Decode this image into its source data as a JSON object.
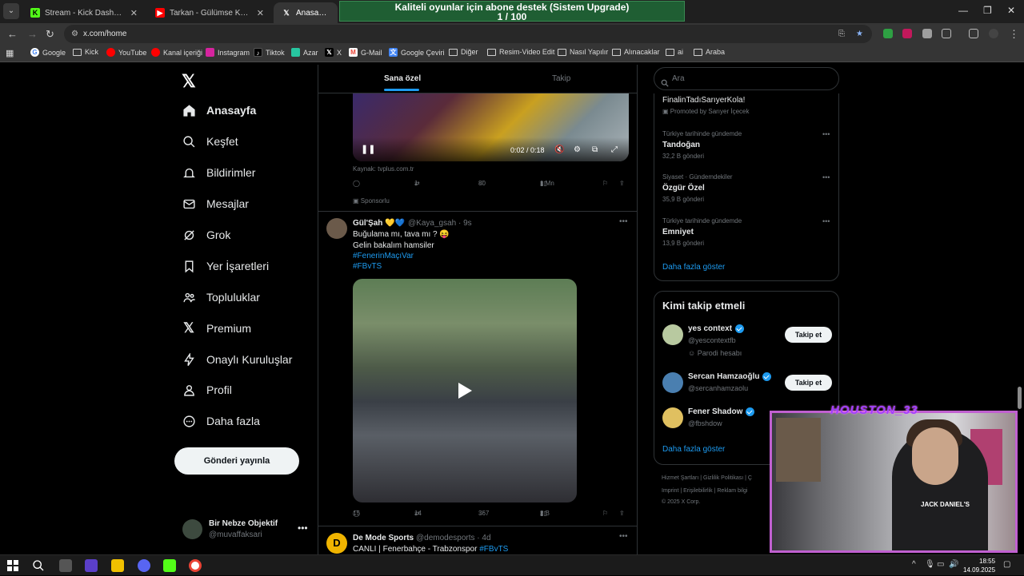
{
  "browser": {
    "tabs": [
      {
        "title": "Stream - Kick Dashboard",
        "favicon": "kick-icon",
        "color": "#53fc18"
      },
      {
        "title": "Tarkan - Gülümse Kaderine (Eng",
        "favicon": "youtube-icon",
        "color": "#ff0000"
      },
      {
        "title": "Anasayfa / X",
        "favicon": "x-icon",
        "color": "#ffffff",
        "active": true
      }
    ],
    "address": "x.com/home",
    "bookmarks": [
      {
        "label": "Google",
        "icon": "google-icon"
      },
      {
        "label": "Kick",
        "icon": "folder-icon"
      },
      {
        "label": "YouTube",
        "icon": "youtube-icon"
      },
      {
        "label": "Kanal içeriği",
        "icon": "youtube-icon"
      },
      {
        "label": "Instagram",
        "icon": "instagram-icon"
      },
      {
        "label": "Tiktok",
        "icon": "tiktok-icon"
      },
      {
        "label": "Azar",
        "icon": "azar-icon"
      },
      {
        "label": "X",
        "icon": "x-icon"
      },
      {
        "label": "G-Mail",
        "icon": "gmail-icon"
      },
      {
        "label": "Google Çeviri",
        "icon": "translate-icon"
      },
      {
        "label": "Diğer",
        "icon": "folder-icon"
      },
      {
        "label": "Resim-Video Edit",
        "icon": "folder-icon"
      },
      {
        "label": "Nasıl Yapılır",
        "icon": "folder-icon"
      },
      {
        "label": "Alınacaklar",
        "icon": "folder-icon"
      },
      {
        "label": "ai",
        "icon": "folder-icon"
      },
      {
        "label": "Araba",
        "icon": "folder-icon"
      }
    ]
  },
  "overlay": {
    "line1": "Kaliteli oyunlar için abone destek (Sistem Upgrade)",
    "line2": "1 / 100"
  },
  "sidebar": {
    "nav": [
      {
        "label": "Anasayfa",
        "icon": "home-icon"
      },
      {
        "label": "Keşfet",
        "icon": "search-icon"
      },
      {
        "label": "Bildirimler",
        "icon": "bell-icon"
      },
      {
        "label": "Mesajlar",
        "icon": "mail-icon"
      },
      {
        "label": "Grok",
        "icon": "grok-icon"
      },
      {
        "label": "Yer İşaretleri",
        "icon": "bookmark-icon"
      },
      {
        "label": "Topluluklar",
        "icon": "people-icon"
      },
      {
        "label": "Premium",
        "icon": "x-icon"
      },
      {
        "label": "Onaylı Kuruluşlar",
        "icon": "lightning-icon"
      },
      {
        "label": "Profil",
        "icon": "person-icon"
      },
      {
        "label": "Daha fazla",
        "icon": "more-circle-icon"
      }
    ],
    "post_button": "Gönderi yayınla",
    "account": {
      "name": "Bir Nebze Objektif",
      "handle": "@muvaffaksari"
    }
  },
  "feed": {
    "tabs": {
      "for_you": "Sana özel",
      "following": "Takip"
    },
    "post1": {
      "time": "0:02 / 0:18",
      "source": "Kaynak: tvplus.com.tr",
      "retweets": "1",
      "likes": "80",
      "views": "1 Mn",
      "sponsored": "Sponsorlu"
    },
    "post2": {
      "name": "Gül'Şah 💛💙",
      "handle": "@Kaya_gsah · 9s",
      "line1": "Buğulama mı, tava mı ? 😝",
      "line2": "Gelin bakalım hamsiler",
      "tag1": "#FenerinMaçıVar",
      "tag2": "#FBvTS",
      "replies": "15",
      "retweets": "14",
      "likes": "367",
      "views": "2 B"
    },
    "post3": {
      "name": "De Mode Sports",
      "handle": "@demodesports · 4d",
      "text": "CANLI | Fenerbahçe - Trabzonspor",
      "tag": "#FBvTS"
    }
  },
  "right": {
    "search_placeholder": "Ara",
    "promo": {
      "title": "FinalinTadıSarıyerKola!",
      "by": "Promoted by Sarıyer İçecek"
    },
    "trends": [
      {
        "context": "Türkiye tarihinde gündemde",
        "name": "Tandoğan",
        "count": "32,2 B gönderi"
      },
      {
        "context": "Siyaset · Gündemdekiler",
        "name": "Özgür Özel",
        "count": "35,9 B gönderi"
      },
      {
        "context": "Türkiye tarihinde gündemde",
        "name": "Emniyet",
        "count": "13,9 B gönderi"
      }
    ],
    "show_more": "Daha fazla göster",
    "who_to_follow": {
      "title": "Kimi takip etmeli",
      "users": [
        {
          "name": "yes context",
          "handle": "@yescontextfb",
          "bio": "Parodi hesabı",
          "button": "Takip et"
        },
        {
          "name": "Sercan Hamzaoğlu",
          "handle": "@sercanhamzaolu",
          "button": "Takip et"
        },
        {
          "name": "Fener Shadow",
          "handle": "@fbshdow"
        }
      ],
      "show_more": "Daha fazla göster"
    },
    "footer": {
      "line1": "Hizmet Şartları  |  Gizlilik Politikası  |  Ç",
      "line2": "Imprint  |  Erişilebilirlik  |  Reklam bilgi",
      "line3": "© 2025 X Corp."
    }
  },
  "webcam": {
    "name": "HOUSTON_33",
    "shirt": "JACK DANIEL'S"
  },
  "taskbar": {
    "time": "18:55",
    "date": "14.09.2025"
  }
}
